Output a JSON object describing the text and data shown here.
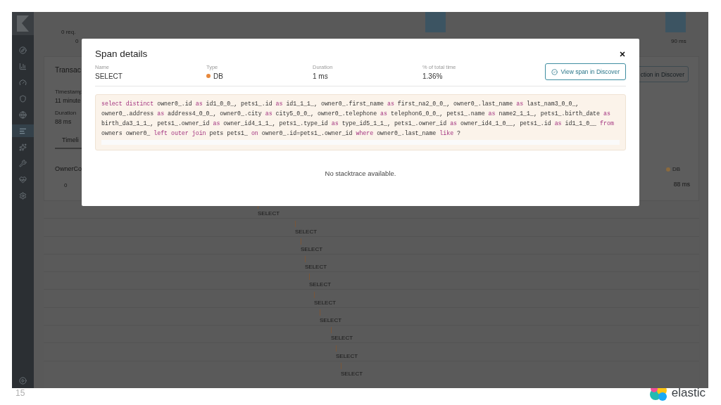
{
  "histogram": {
    "y_label": "0 req.",
    "x_start": "0",
    "x_end": "90 ms"
  },
  "sidebar": {
    "items": [
      {
        "selected": false
      },
      {
        "selected": false
      },
      {
        "selected": false
      },
      {
        "selected": false
      },
      {
        "selected": false
      },
      {
        "selected": true
      },
      {
        "selected": false
      },
      {
        "selected": false
      },
      {
        "selected": false
      },
      {
        "selected": false
      }
    ]
  },
  "transaction": {
    "title": "Transac",
    "fields": [
      {
        "label": "Timestamp",
        "value": "11 minute"
      },
      {
        "label": "Duration",
        "value": "88 ms"
      }
    ],
    "discover_button": "ction in Discover",
    "tabs": [
      {
        "label": "Timeli",
        "selected": true
      }
    ],
    "service": {
      "name": "OwnerCo",
      "axis_start": "0",
      "legend": "DB",
      "axis_end": "88 ms"
    }
  },
  "timeline": {
    "spans": [
      {
        "name": "SELECT"
      },
      {
        "name": "SELECT"
      },
      {
        "name": "SELECT"
      },
      {
        "name": "SELECT"
      },
      {
        "name": "SELECT"
      },
      {
        "name": "SELECT"
      },
      {
        "name": "SELECT"
      },
      {
        "name": "SELECT"
      },
      {
        "name": "SELECT"
      },
      {
        "name": "SELECT"
      }
    ]
  },
  "modal": {
    "title": "Span details",
    "fields": [
      {
        "label": "Name",
        "value": "SELECT",
        "kind": "text"
      },
      {
        "label": "Type",
        "value": "DB",
        "kind": "dot"
      },
      {
        "label": "Duration",
        "value": "1 ms",
        "kind": "text"
      },
      {
        "label": "% of total time",
        "value": "1.36%",
        "kind": "text"
      }
    ],
    "button": "View span in Discover",
    "code": [
      [
        {
          "kind": "keyword",
          "text": "select distinct"
        },
        {
          "kind": "plain",
          "text": " owner0_.id "
        },
        {
          "kind": "keyword",
          "text": "as"
        },
        {
          "kind": "plain",
          "text": " id1_0_0_, pets1_.id "
        },
        {
          "kind": "keyword",
          "text": "as"
        },
        {
          "kind": "plain",
          "text": " id1_1_1_, owner0_.first_name "
        },
        {
          "kind": "keyword",
          "text": "as"
        },
        {
          "kind": "plain",
          "text": " first_na2_0_0_, owner0_.last_name "
        },
        {
          "kind": "keyword",
          "text": "as"
        },
        {
          "kind": "plain",
          "text": " last_nam3_0_0_,"
        }
      ],
      [
        {
          "kind": "plain",
          "text": "owner0_.address "
        },
        {
          "kind": "keyword",
          "text": "as"
        },
        {
          "kind": "plain",
          "text": " address4_0_0_, owner0_.city "
        },
        {
          "kind": "keyword",
          "text": "as"
        },
        {
          "kind": "plain",
          "text": " city5_0_0_, owner0_.telephone "
        },
        {
          "kind": "keyword",
          "text": "as"
        },
        {
          "kind": "plain",
          "text": " telephon6_0_0_, pets1_.name "
        },
        {
          "kind": "keyword",
          "text": "as"
        },
        {
          "kind": "plain",
          "text": " name2_1_1_, pets1_.birth_date "
        },
        {
          "kind": "keyword",
          "text": "as"
        }
      ],
      [
        {
          "kind": "plain",
          "text": "birth_da3_1_1_, pets1_.owner_id "
        },
        {
          "kind": "keyword",
          "text": "as"
        },
        {
          "kind": "plain",
          "text": " owner_id4_1_1_, pets1_.type_id "
        },
        {
          "kind": "keyword",
          "text": "as"
        },
        {
          "kind": "plain",
          "text": " type_id5_1_1_, pets1_.owner_id "
        },
        {
          "kind": "keyword",
          "text": "as"
        },
        {
          "kind": "plain",
          "text": " owner_id4_1_0__, pets1_.id "
        },
        {
          "kind": "keyword",
          "text": "as"
        },
        {
          "kind": "plain",
          "text": " id1_1_0__ "
        },
        {
          "kind": "keyword",
          "text": "from"
        }
      ],
      [
        {
          "kind": "plain",
          "text": "owners owner0_ "
        },
        {
          "kind": "keyword",
          "text": "left outer join"
        },
        {
          "kind": "plain",
          "text": " pets pets1_ "
        },
        {
          "kind": "keyword",
          "text": "on"
        },
        {
          "kind": "plain",
          "text": " owner0_.id=pets1_.owner_id "
        },
        {
          "kind": "keyword",
          "text": "where"
        },
        {
          "kind": "plain",
          "text": " owner0_.last_name "
        },
        {
          "kind": "keyword",
          "text": "like"
        },
        {
          "kind": "plain",
          "text": " ?"
        }
      ]
    ],
    "stacktrace": "No stacktrace available."
  },
  "slide": {
    "number": "15",
    "logo_text": "elastic"
  }
}
